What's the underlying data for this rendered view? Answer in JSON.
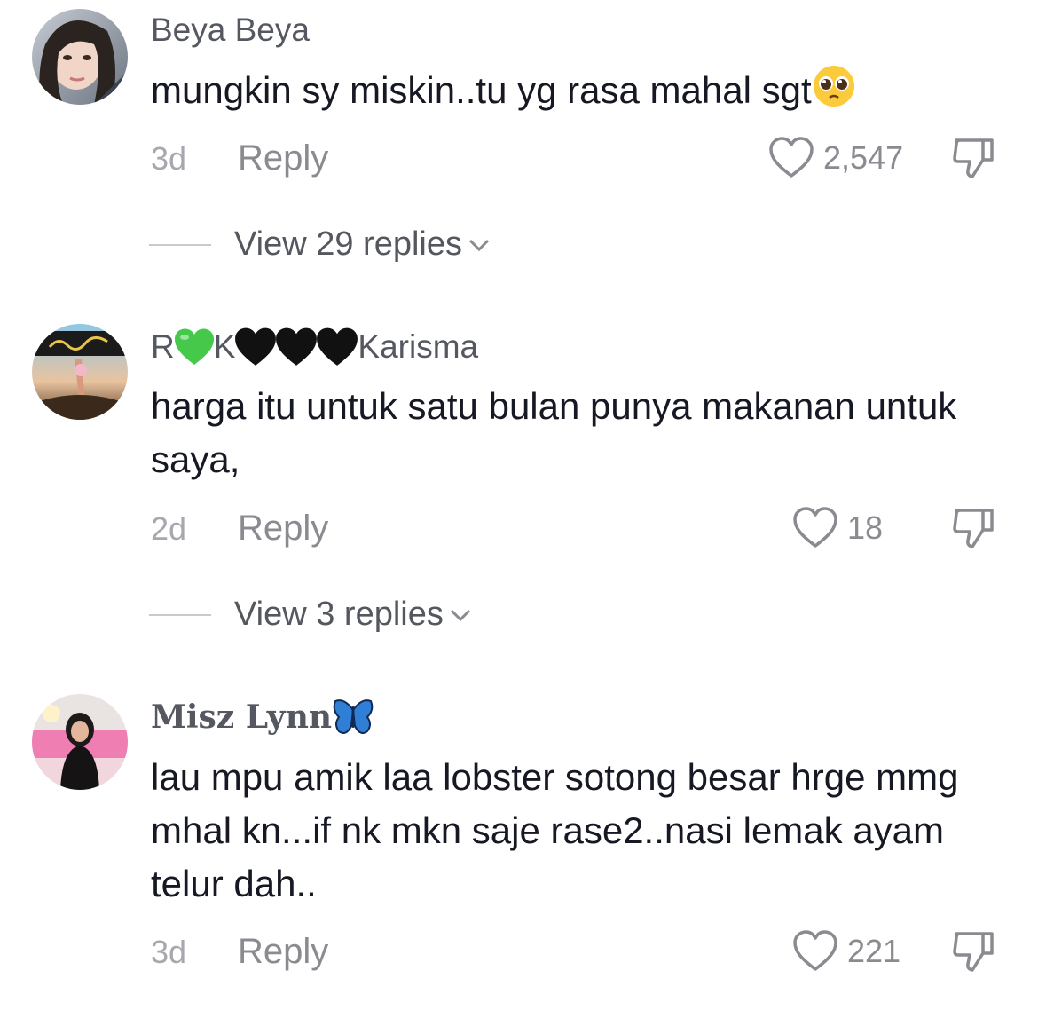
{
  "comments": [
    {
      "username": "Beya Beya",
      "text": "mungkin sy miskin..tu yg rasa mahal sgt",
      "text_emoji": "pleading-face",
      "time": "3d",
      "reply_label": "Reply",
      "likes": "2,547",
      "view_replies": "View 29 replies"
    },
    {
      "username_parts": [
        "R",
        "K ",
        "Karisma"
      ],
      "username_emojis": [
        "green-heart",
        "black-heart",
        "black-heart",
        "black-heart"
      ],
      "text": "harga itu untuk satu bulan punya makanan untuk saya,",
      "time": "2d",
      "reply_label": "Reply",
      "likes": "18",
      "view_replies": "View 3 replies"
    },
    {
      "username": "Misz Lynn",
      "username_emoji": "butterfly",
      "text": "lau mpu amik laa lobster sotong besar hrge mmg mhal kn...if nk mkn saje rase2..nasi lemak ayam telur dah..",
      "time": "3d",
      "reply_label": "Reply",
      "likes": "221"
    }
  ],
  "icons": {
    "like": "heart-outline-icon",
    "dislike": "thumbs-down-icon",
    "expand": "chevron-down-icon"
  },
  "colors": {
    "background": "#ffffff",
    "text_primary": "#161823",
    "text_secondary": "#8a8b91",
    "green_heart": "#46c84a",
    "black_heart": "#111111",
    "butterfly": "#2f7fd6"
  }
}
